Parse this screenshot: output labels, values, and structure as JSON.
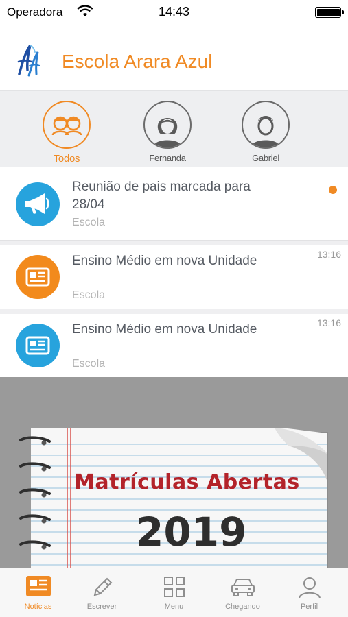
{
  "status_bar": {
    "carrier": "Operadora",
    "time": "14:43"
  },
  "header": {
    "school_name": "Escola Arara Azul"
  },
  "profiles": [
    {
      "label": "Todos",
      "active": true
    },
    {
      "label": "Fernanda",
      "active": false
    },
    {
      "label": "Gabriel",
      "active": false
    }
  ],
  "news": [
    {
      "title": "Reunião de pais marcada para 28/04",
      "source": "Escola",
      "time": "",
      "icon": "megaphone-icon",
      "unread": true
    },
    {
      "title": "Ensino Médio em nova Unidade",
      "source": "Escola",
      "time": "13:16",
      "icon": "newspaper-icon"
    },
    {
      "title": "Ensino Médio em nova Unidade",
      "source": "Escola",
      "time": "13:16",
      "icon": "newspaper-icon"
    }
  ],
  "banner": {
    "line1": "Matrículas Abertas",
    "line2": "2019"
  },
  "tabs": [
    {
      "label": "Notícias",
      "active": true
    },
    {
      "label": "Escrever"
    },
    {
      "label": "Menu"
    },
    {
      "label": "Chegando"
    },
    {
      "label": "Perfil"
    }
  ],
  "colors": {
    "accent": "#f08a24",
    "blue": "#27a3dd",
    "orange": "#f28a1c"
  }
}
